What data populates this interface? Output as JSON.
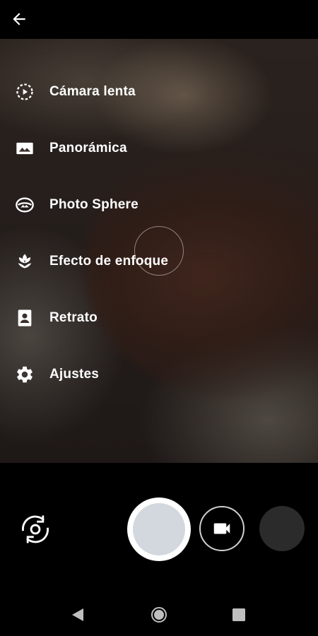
{
  "header": {
    "back_icon": "arrow-back-icon"
  },
  "menu": {
    "items": [
      {
        "label": "Cámara lenta",
        "icon": "slow-motion-icon"
      },
      {
        "label": "Panorámica",
        "icon": "panorama-icon"
      },
      {
        "label": "Photo Sphere",
        "icon": "photo-sphere-icon"
      },
      {
        "label": "Efecto de enfoque",
        "icon": "tulip-icon"
      },
      {
        "label": "Retrato",
        "icon": "portrait-icon"
      },
      {
        "label": "Ajustes",
        "icon": "gear-icon"
      }
    ]
  },
  "controls": {
    "switch_camera_icon": "switch-camera-icon",
    "shutter": "shutter-button",
    "video_icon": "video-camera-icon",
    "gallery": "gallery-thumbnail"
  },
  "navbar": {
    "items": [
      "back-triangle-icon",
      "home-circle-icon",
      "recents-square-icon"
    ]
  },
  "colors": {
    "background": "#000000",
    "shutter_inner": "#d3d8de",
    "thumbnail": "#2b2b2b"
  }
}
